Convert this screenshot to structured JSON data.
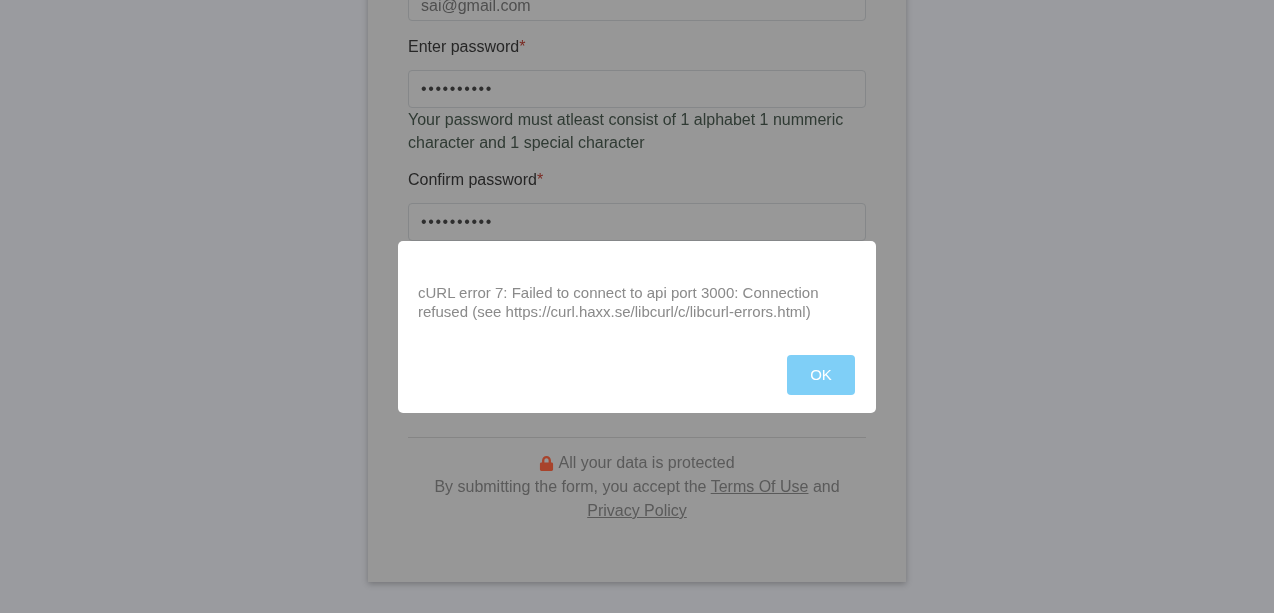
{
  "form": {
    "fields": [
      {
        "kind": "email",
        "value": "sai@gmail.com"
      },
      {
        "kind": "password",
        "label": "Enter password",
        "required_mark": "*",
        "value": "••••••••••",
        "hint": "Your password must atleast consist of 1 alphabet 1 nummeric character and 1 special character"
      },
      {
        "kind": "password",
        "label": "Confirm password",
        "required_mark": "*",
        "value": "••••••••••"
      }
    ]
  },
  "footer": {
    "security_note": "All your data is protected",
    "consent": {
      "text_before": "By submitting the form, you accept the",
      "terms_link": "Terms Of Use",
      "text_middle": "and",
      "privacy_link": "Privacy Policy"
    }
  },
  "dialog": {
    "message": "cURL error 7: Failed to connect to api port 3000: Connection refused (see https://curl.haxx.se/libcurl/c/libcurl-errors.html)",
    "buttons": [
      "OK"
    ]
  }
}
